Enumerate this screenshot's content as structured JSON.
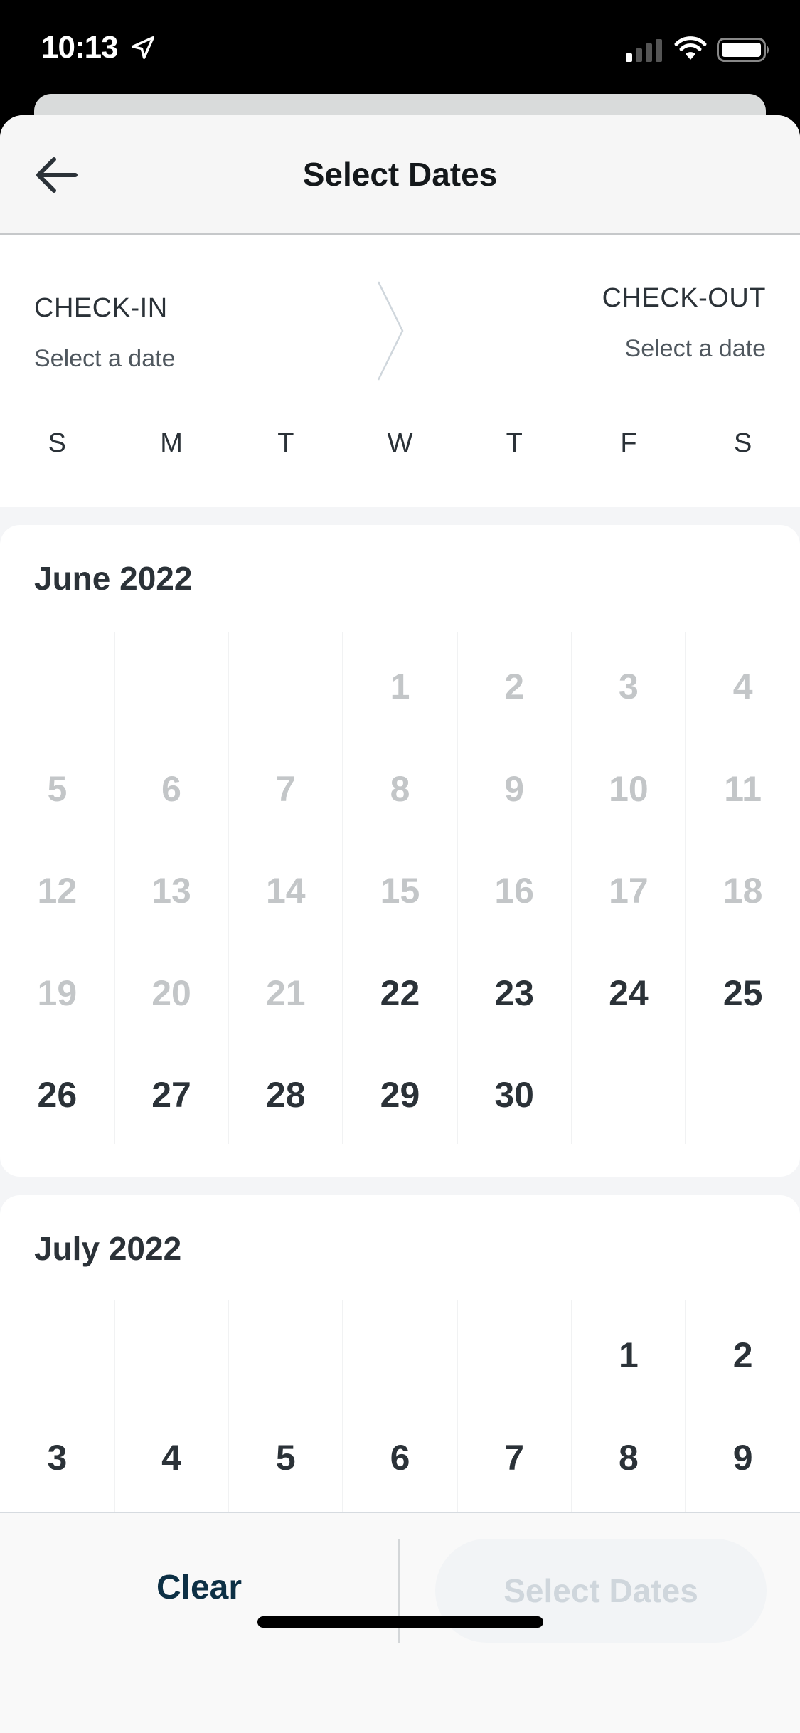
{
  "status_bar": {
    "time": "10:13",
    "icons": [
      "location-arrow-icon",
      "cellular-signal-icon",
      "wifi-icon",
      "battery-icon"
    ]
  },
  "header": {
    "title": "Select Dates",
    "back_icon": "arrow-left-icon"
  },
  "check_in": {
    "label": "CHECK-IN",
    "value": "Select a date"
  },
  "check_out": {
    "label": "CHECK-OUT",
    "value": "Select a date"
  },
  "weekdays": [
    "S",
    "M",
    "T",
    "W",
    "T",
    "F",
    "S"
  ],
  "months": [
    {
      "title": "June 2022",
      "first_weekday_index": 3,
      "days_in_month": 30,
      "first_available_day": 22
    },
    {
      "title": "July 2022",
      "first_weekday_index": 5,
      "days_in_month": 31,
      "first_available_day": 1,
      "visible_days": [
        1,
        2,
        3,
        4,
        5,
        6,
        7,
        8,
        9
      ]
    }
  ],
  "footer": {
    "clear_label": "Clear",
    "select_label": "Select Dates",
    "select_enabled": false
  },
  "colors": {
    "text_primary": "#2b3238",
    "text_disabled_day": "#c3c6c8",
    "clear_button": "#0d3045",
    "select_button_disabled_bg": "#f2f4f6",
    "select_button_disabled_text": "#cfd6dc"
  }
}
